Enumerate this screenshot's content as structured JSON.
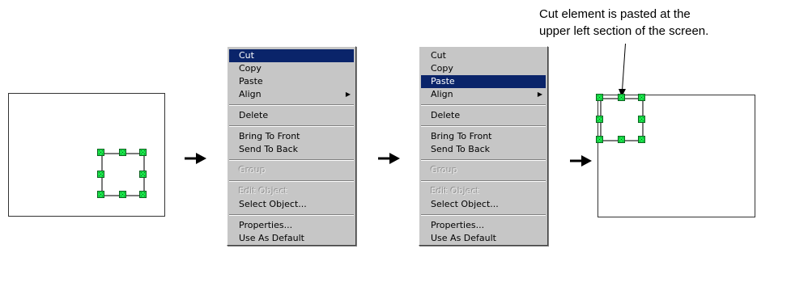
{
  "annotation": {
    "line1": "Cut element is pasted at the",
    "line2": "upper left section of the screen."
  },
  "menu_items": [
    {
      "label": "Cut",
      "enabled": true,
      "submenu": false
    },
    {
      "label": "Copy",
      "enabled": true,
      "submenu": false
    },
    {
      "label": "Paste",
      "enabled": true,
      "submenu": false
    },
    {
      "label": "Align",
      "enabled": true,
      "submenu": true
    },
    {
      "label": "Delete",
      "enabled": true,
      "submenu": false
    },
    {
      "label": "Bring To Front",
      "enabled": true,
      "submenu": false
    },
    {
      "label": "Send To Back",
      "enabled": true,
      "submenu": false
    },
    {
      "label": "Group",
      "enabled": false,
      "submenu": false
    },
    {
      "label": "Edit Object",
      "enabled": false,
      "submenu": false
    },
    {
      "label": "Select Object...",
      "enabled": true,
      "submenu": false
    },
    {
      "label": "Properties...",
      "enabled": true,
      "submenu": false
    },
    {
      "label": "Use As Default",
      "enabled": true,
      "submenu": false
    }
  ],
  "menus": [
    {
      "highlighted": "Cut"
    },
    {
      "highlighted": "Paste"
    }
  ],
  "colors": {
    "highlight": "#0a246a",
    "menu_bg": "#c6c6c6",
    "handle": "#19e64a"
  },
  "icons": {
    "step_arrow": "right-arrow-icon",
    "submenu_arrow": "submenu-arrow-icon"
  }
}
